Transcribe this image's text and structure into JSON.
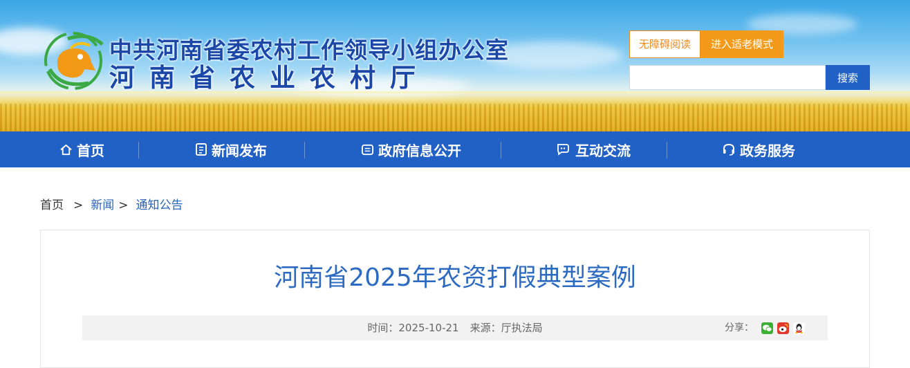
{
  "header": {
    "title_line1": "中共河南省委农村工作领导小组办公室",
    "title_line2": "河南省农业农村厅",
    "accessibility_button": "无障碍阅读",
    "elder_mode_button": "进入适老模式",
    "search_placeholder": "",
    "search_button": "搜索"
  },
  "nav": {
    "items": [
      {
        "label": "首页",
        "icon": "home-icon"
      },
      {
        "label": "新闻发布",
        "icon": "document-icon"
      },
      {
        "label": "政府信息公开",
        "icon": "info-icon"
      },
      {
        "label": "互动交流",
        "icon": "chat-icon"
      },
      {
        "label": "政务服务",
        "icon": "headset-icon"
      }
    ]
  },
  "breadcrumb": {
    "home": "首页",
    "sep": ">",
    "news": "新闻",
    "notice": "通知公告"
  },
  "article": {
    "title": "河南省2025年农资打假典型案例",
    "time": "时间：2025-10-21",
    "source": "来源：厅执法局",
    "share_label": "分享：",
    "share_icons": [
      "wechat-icon",
      "weibo-icon",
      "qq-icon"
    ]
  },
  "colors": {
    "nav_blue": "#2160c4",
    "title_blue": "#2d6bc2",
    "accent_orange": "#f39a1b"
  }
}
